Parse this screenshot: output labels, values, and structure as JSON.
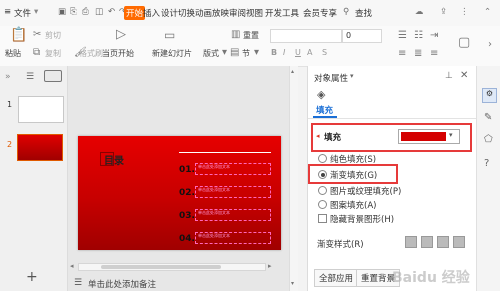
{
  "menubar": {
    "file_label": "文件",
    "tabs": [
      "开始",
      "插入",
      "设计",
      "切换",
      "动画",
      "放映",
      "审阅",
      "视图",
      "开发工具",
      "会员专享"
    ],
    "search_label": "查找"
  },
  "ribbon": {
    "cut": "剪切",
    "copy": "复制",
    "format_painter": "格式刷",
    "paste": "粘贴",
    "from_current": "当页开始",
    "new_slide": "新建幻灯片",
    "layout": "版式",
    "section": "节",
    "reset": "重置",
    "font_size": "0"
  },
  "slides": {
    "numbers": [
      "1",
      "2"
    ],
    "add_label": "+"
  },
  "slide": {
    "title": "目录",
    "items": [
      {
        "num": "01.",
        "text": "单击此处添加文本"
      },
      {
        "num": "02.",
        "text": "单击此处添加文本"
      },
      {
        "num": "03.",
        "text": "单击此处添加文本"
      },
      {
        "num": "04.",
        "text": "单击此处添加文本"
      }
    ]
  },
  "notes": {
    "label": "单击此处添加备注"
  },
  "panel": {
    "title": "对象属性",
    "tab": "填充",
    "fill_header": "填充",
    "fill_color": "#d40000",
    "options": [
      "纯色填充(S)",
      "渐变填充(G)",
      "图片或纹理填充(P)",
      "图案填充(A)",
      "隐藏背景图形(H)"
    ],
    "gradient_style_label": "渐变样式(R)",
    "apply_all": "全部应用",
    "reset_bg": "重置背景"
  },
  "watermark": "Baidu 经验"
}
